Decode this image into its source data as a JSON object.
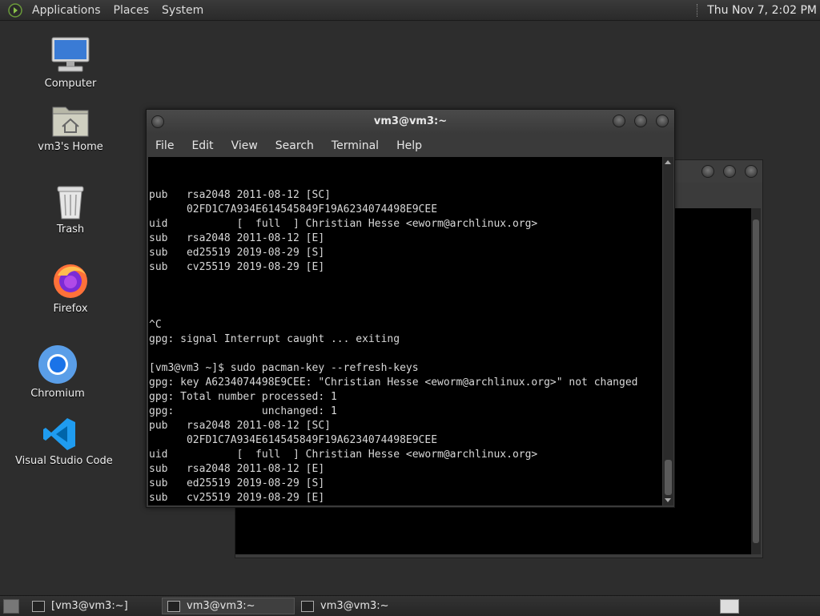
{
  "top_panel": {
    "menus": [
      "Applications",
      "Places",
      "System"
    ],
    "clock": "Thu Nov  7,  2:02 PM"
  },
  "desktop_icons": [
    {
      "label": "Computer",
      "icon": "computer-icon"
    },
    {
      "label": "vm3's Home",
      "icon": "home-folder-icon"
    },
    {
      "label": "Trash",
      "icon": "trash-icon"
    },
    {
      "label": "Firefox",
      "icon": "firefox-icon"
    },
    {
      "label": "Chromium",
      "icon": "chromium-icon"
    },
    {
      "label": "Visual Studio Code",
      "icon": "vscode-icon"
    }
  ],
  "terminal": {
    "title": "vm3@vm3:~",
    "menus": [
      "File",
      "Edit",
      "View",
      "Search",
      "Terminal",
      "Help"
    ],
    "lines": [
      "pub   rsa2048 2011-08-12 [SC]",
      "      02FD1C7A934E614545849F19A6234074498E9CEE",
      "uid           [  full  ] Christian Hesse <eworm@archlinux.org>",
      "sub   rsa2048 2011-08-12 [E]",
      "sub   ed25519 2019-08-29 [S]",
      "sub   cv25519 2019-08-29 [E]",
      "",
      "",
      "",
      "^C",
      "gpg: signal Interrupt caught ... exiting",
      "",
      "[vm3@vm3 ~]$ sudo pacman-key --refresh-keys",
      "gpg: key A6234074498E9CEE: \"Christian Hesse <eworm@archlinux.org>\" not changed",
      "gpg: Total number processed: 1",
      "gpg:              unchanged: 1",
      "pub   rsa2048 2011-08-12 [SC]",
      "      02FD1C7A934E614545849F19A6234074498E9CEE",
      "uid           [  full  ] Christian Hesse <eworm@archlinux.org>",
      "sub   rsa2048 2011-08-12 [E]",
      "sub   ed25519 2019-08-29 [S]",
      "sub   cv25519 2019-08-29 [E]",
      ""
    ]
  },
  "taskbar": {
    "items": [
      {
        "label": "[vm3@vm3:~]",
        "active": false
      },
      {
        "label": "vm3@vm3:~",
        "active": true
      },
      {
        "label": "vm3@vm3:~",
        "active": false
      }
    ]
  },
  "colors": {
    "desktop_bg": "#2d2d2d",
    "terminal_bg": "#000000",
    "terminal_fg": "#d8d8d8"
  }
}
